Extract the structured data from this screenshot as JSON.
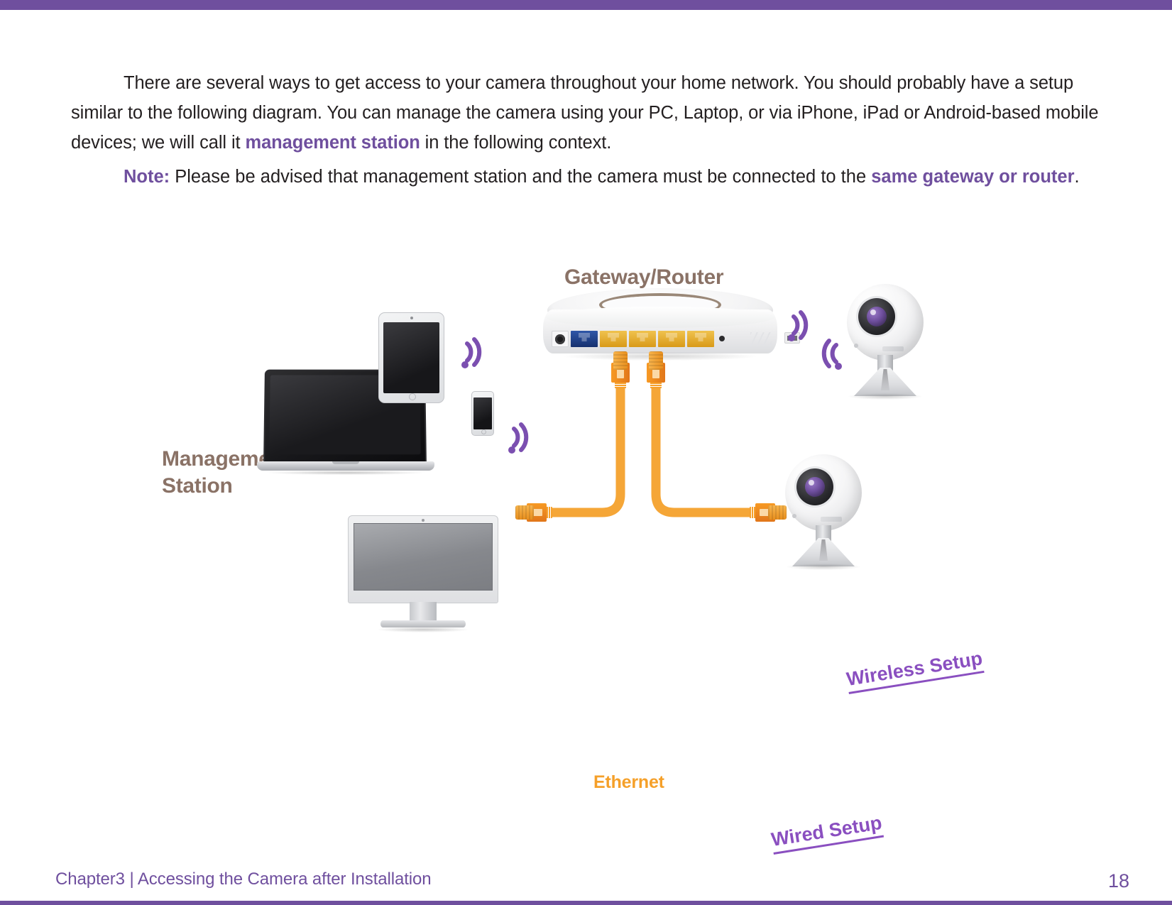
{
  "page": {
    "accent_purple": "#6f4f9e",
    "label_brown": "#8a7266",
    "ethernet_orange": "#f5a02a",
    "link_purple": "#8a4fc0"
  },
  "body_text": {
    "para1_part1": "There are several ways to get access to your camera throughout your home network. You should probably have a setup similar to the following diagram. You can manage the camera using your PC, Laptop,  or via iPhone, iPad or Android-based mobile devices; we will call it ",
    "para1_bold": "management station",
    "para1_part2": " in the following context.",
    "note_label": "Note:",
    "note_part1": " Please be advised that management station and the camera must be connected to the ",
    "note_bold": "same gateway or router",
    "note_part2": "."
  },
  "diagram": {
    "gateway_label": "Gateway/Router",
    "management_label_line1": "Management",
    "management_label_line2": "Station",
    "ethernet_label": "Ethernet",
    "wireless_setup_label": "Wireless Setup",
    "wired_setup_label": "Wired Setup"
  },
  "footer": {
    "chapter_text": "Chapter3  |  Accessing the Camera after Installation",
    "page_number": "18"
  }
}
